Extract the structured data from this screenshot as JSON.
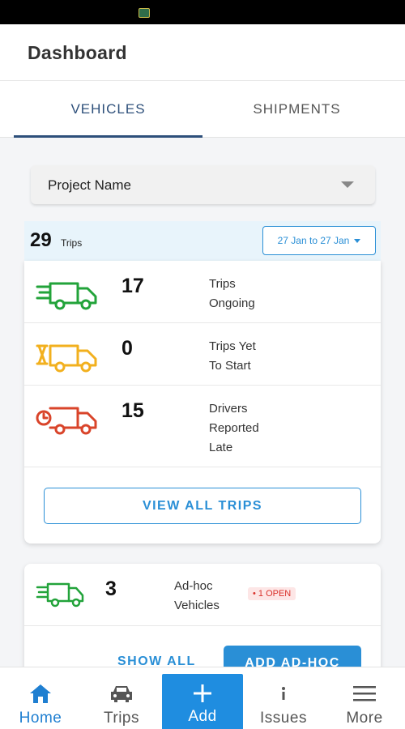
{
  "header": {
    "title": "Dashboard"
  },
  "tabs": [
    {
      "label": "VEHICLES"
    },
    {
      "label": "SHIPMENTS"
    }
  ],
  "project_select": {
    "value": "Project Name"
  },
  "summary": {
    "count": "29",
    "unit": "Trips",
    "date_range": "27 Jan to 27 Jan"
  },
  "trip_stats": [
    {
      "value": "17",
      "label_lines": [
        "Trips",
        "Ongoing"
      ],
      "icon": "truck-moving-icon",
      "color": "#22a33a"
    },
    {
      "value": "0",
      "label_lines": [
        "Trips Yet",
        "To Start"
      ],
      "icon": "truck-hourglass-icon",
      "color": "#f2b01e"
    },
    {
      "value": "15",
      "label_lines": [
        "Drivers",
        "Reported",
        "Late"
      ],
      "icon": "truck-clock-icon",
      "color": "#d9442a"
    }
  ],
  "view_all_label": "VIEW ALL TRIPS",
  "adhoc": {
    "value": "3",
    "label_lines": [
      "Ad-hoc",
      "Vehicles"
    ],
    "badge": "• 1 OPEN",
    "show_all_label": "SHOW ALL",
    "add_label": "ADD AD-HOC"
  },
  "bottom_nav": [
    {
      "label": "Home",
      "icon": "home-icon"
    },
    {
      "label": "Trips",
      "icon": "car-icon"
    },
    {
      "label": "Add",
      "icon": "plus-icon"
    },
    {
      "label": "Issues",
      "icon": "info-icon"
    },
    {
      "label": "More",
      "icon": "menu-icon"
    }
  ],
  "colors": {
    "accent": "#2a8fd6",
    "tab_active": "#2d4f7a",
    "summary_bg": "#e8f4fb"
  }
}
